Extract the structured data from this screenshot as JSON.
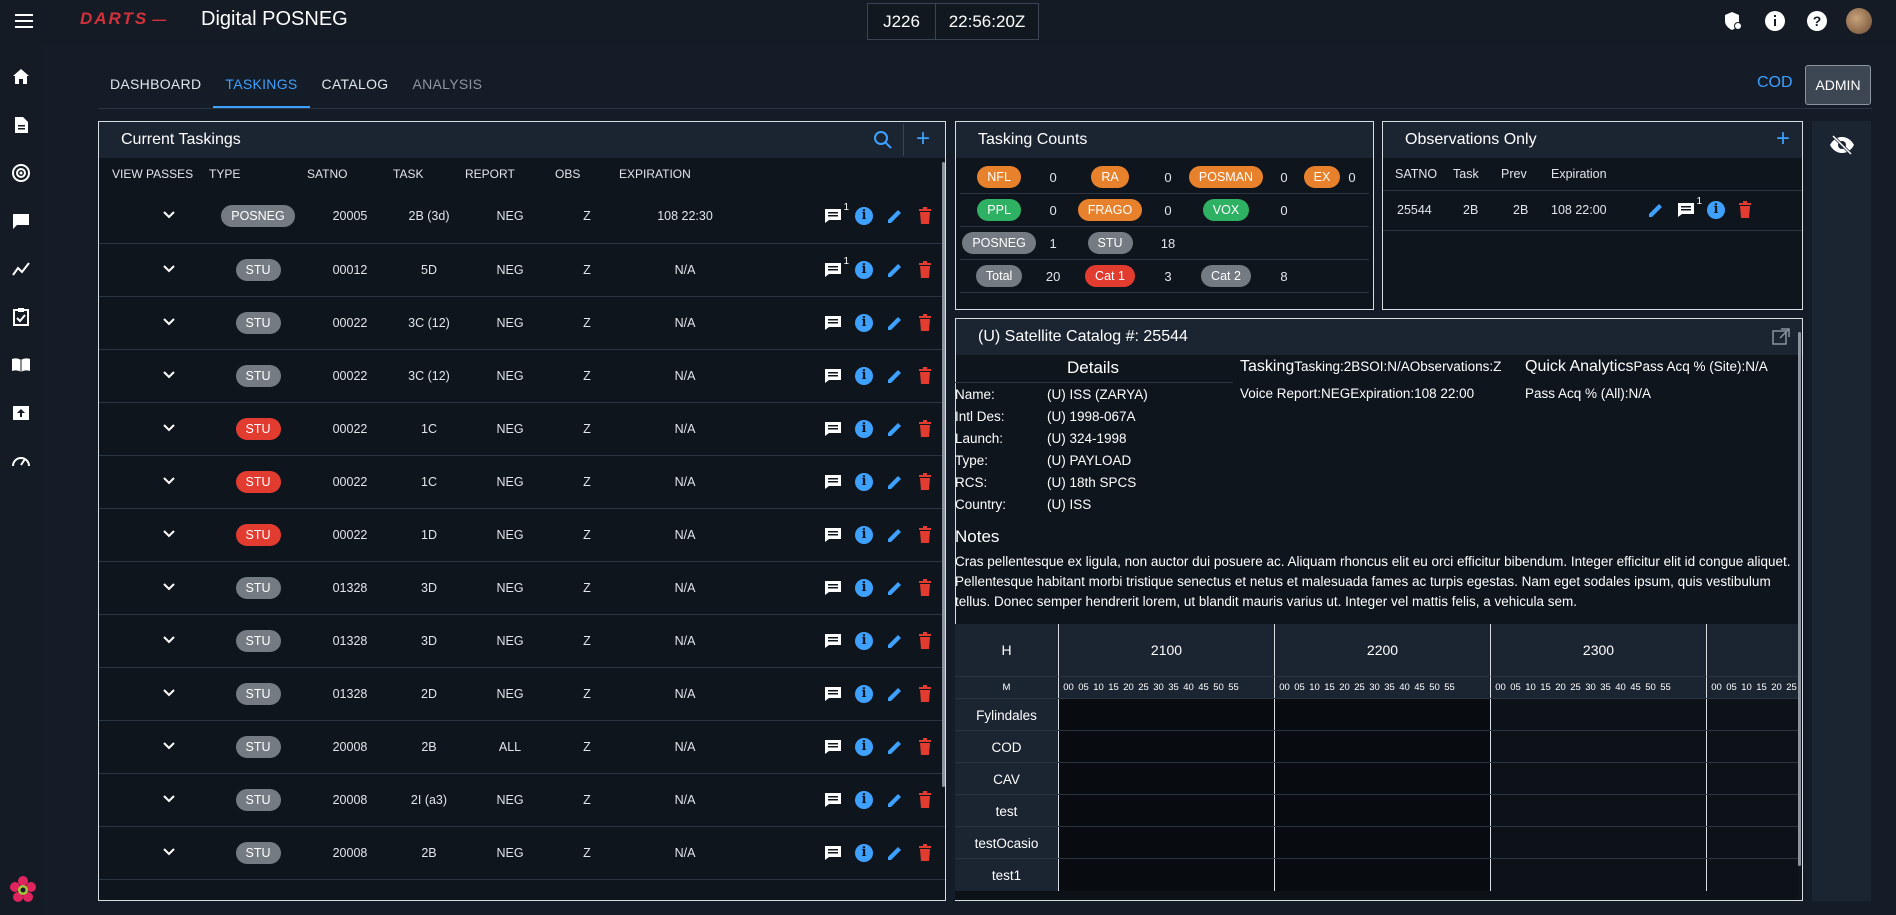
{
  "app": {
    "logo": "DARTS",
    "title": "Digital POSNEG",
    "day": "J226",
    "time": "22:56:20Z"
  },
  "topbar_icons": [
    "shield-alert-icon",
    "info-icon",
    "help-icon",
    "user-avatar"
  ],
  "sidebar": [
    "home-icon",
    "document-icon",
    "radar-icon",
    "chat-icon",
    "chart-line-icon",
    "clipboard-icon",
    "book-icon",
    "upload-icon",
    "gauge-icon"
  ],
  "tabs": [
    {
      "label": "DASHBOARD",
      "state": "normal"
    },
    {
      "label": "TASKINGS",
      "state": "active"
    },
    {
      "label": "CATALOG",
      "state": "normal"
    },
    {
      "label": "ANALYSIS",
      "state": "disabled"
    }
  ],
  "header_right": {
    "cod": "COD",
    "admin": "ADMIN"
  },
  "current_taskings": {
    "title": "Current Taskings",
    "columns": [
      "VIEW PASSES",
      "TYPE",
      "SATNO",
      "TASK",
      "REPORT",
      "OBS",
      "EXPIRATION"
    ],
    "rows": [
      {
        "type": "POSNEG",
        "type_color": "grey",
        "satno": "20005",
        "task": "2B (3d)",
        "report": "NEG",
        "obs": "Z",
        "exp": "108 22:30",
        "msg_count": "1"
      },
      {
        "type": "STU",
        "type_color": "grey",
        "satno": "00012",
        "task": "5D",
        "report": "NEG",
        "obs": "Z",
        "exp": "N/A",
        "msg_count": "1"
      },
      {
        "type": "STU",
        "type_color": "grey",
        "satno": "00022",
        "task": "3C (12)",
        "report": "NEG",
        "obs": "Z",
        "exp": "N/A",
        "msg_count": ""
      },
      {
        "type": "STU",
        "type_color": "grey",
        "satno": "00022",
        "task": "3C (12)",
        "report": "NEG",
        "obs": "Z",
        "exp": "N/A",
        "msg_count": ""
      },
      {
        "type": "STU",
        "type_color": "red",
        "satno": "00022",
        "task": "1C",
        "report": "NEG",
        "obs": "Z",
        "exp": "N/A",
        "msg_count": ""
      },
      {
        "type": "STU",
        "type_color": "red",
        "satno": "00022",
        "task": "1C",
        "report": "NEG",
        "obs": "Z",
        "exp": "N/A",
        "msg_count": ""
      },
      {
        "type": "STU",
        "type_color": "red",
        "satno": "00022",
        "task": "1D",
        "report": "NEG",
        "obs": "Z",
        "exp": "N/A",
        "msg_count": ""
      },
      {
        "type": "STU",
        "type_color": "grey",
        "satno": "01328",
        "task": "3D",
        "report": "NEG",
        "obs": "Z",
        "exp": "N/A",
        "msg_count": ""
      },
      {
        "type": "STU",
        "type_color": "grey",
        "satno": "01328",
        "task": "3D",
        "report": "NEG",
        "obs": "Z",
        "exp": "N/A",
        "msg_count": ""
      },
      {
        "type": "STU",
        "type_color": "grey",
        "satno": "01328",
        "task": "2D",
        "report": "NEG",
        "obs": "Z",
        "exp": "N/A",
        "msg_count": ""
      },
      {
        "type": "STU",
        "type_color": "grey",
        "satno": "20008",
        "task": "2B",
        "report": "ALL",
        "obs": "Z",
        "exp": "N/A",
        "msg_count": ""
      },
      {
        "type": "STU",
        "type_color": "grey",
        "satno": "20008",
        "task": "2I (a3)",
        "report": "NEG",
        "obs": "Z",
        "exp": "N/A",
        "msg_count": ""
      },
      {
        "type": "STU",
        "type_color": "grey",
        "satno": "20008",
        "task": "2B",
        "report": "NEG",
        "obs": "Z",
        "exp": "N/A",
        "msg_count": ""
      }
    ]
  },
  "tasking_counts": {
    "title": "Tasking Counts",
    "rows": [
      [
        {
          "label": "NFL",
          "color": "orange",
          "count": "0"
        },
        {
          "label": "RA",
          "color": "orange",
          "count": "0"
        },
        {
          "label": "POSMAN",
          "color": "orange",
          "count": "0"
        },
        {
          "label": "EX",
          "color": "orange",
          "count": "0"
        }
      ],
      [
        {
          "label": "PPL",
          "color": "green",
          "count": "0"
        },
        {
          "label": "FRAGO",
          "color": "orange",
          "count": "0"
        },
        {
          "label": "VOX",
          "color": "green",
          "count": "0"
        }
      ],
      [
        {
          "label": "POSNEG",
          "color": "grey",
          "count": "1"
        },
        {
          "label": "STU",
          "color": "grey",
          "count": "18"
        }
      ],
      [
        {
          "label": "Total",
          "color": "grey",
          "count": "20"
        },
        {
          "label": "Cat 1",
          "color": "red",
          "count": "3"
        },
        {
          "label": "Cat 2",
          "color": "grey",
          "count": "8"
        }
      ]
    ]
  },
  "observations": {
    "title": "Observations Only",
    "columns": [
      "SATNO",
      "Task",
      "Prev",
      "Expiration"
    ],
    "rows": [
      {
        "satno": "25544",
        "task": "2B",
        "prev": "2B",
        "exp": "108 22:00",
        "msg_count": "1"
      }
    ]
  },
  "catalog": {
    "title": "(U) Satellite Catalog #: 25544",
    "details_title": "Details",
    "details": [
      {
        "label": "Name:",
        "value": "(U) ISS (ZARYA)"
      },
      {
        "label": "Intl Des:",
        "value": "(U) 1998-067A"
      },
      {
        "label": "Launch:",
        "value": "(U) 324-1998"
      },
      {
        "label": "Type:",
        "value": "(U) PAYLOAD"
      },
      {
        "label": "RCS:",
        "value": "(U) 18th SPCS"
      },
      {
        "label": "Country:",
        "value": "(U) ISS"
      }
    ],
    "tasking_title": "Tasking",
    "tasking_line1": "Tasking:2BSOI:N/AObservations:Z",
    "tasking_line2": "Voice Report:NEGExpiration:108 22:00",
    "qa_title": "Quick Analytics",
    "qa_line1": "Pass Acq % (Site):N/A",
    "qa_line2": "Pass Acq % (All):N/A",
    "notes_title": "Notes",
    "notes": "Cras pellentesque ex ligula, non auctor dui posuere ac. Aliquam rhoncus elit eu orci efficitur bibendum. Integer efficitur elit id congue aliquet. Pellentesque habitant morbi tristique senectus et netus et malesuada fames ac turpis egestas. Nam eget sodales ipsum, quis vestibulum tellus. Donec semper hendrerit lorem, ut blandit mauris varius ut. Integer vel mattis felis, a vehicula sem.",
    "schedule": {
      "h_label": "H",
      "m_label": "M",
      "hours": [
        "2100",
        "2200",
        "2300",
        ""
      ],
      "minutes": [
        "00",
        "05",
        "10",
        "15",
        "20",
        "25",
        "30",
        "35",
        "40",
        "45",
        "50",
        "55"
      ],
      "sites": [
        "Fylindales",
        "COD",
        "CAV",
        "test",
        "testOcasio",
        "test1"
      ]
    }
  }
}
